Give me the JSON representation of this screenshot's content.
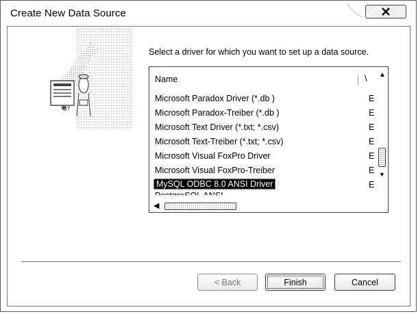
{
  "window": {
    "title": "Create New Data Source",
    "close_icon": "close-icon"
  },
  "main": {
    "prompt": "Select a driver for which you want to set up a data source.",
    "list": {
      "columns": [
        "Name",
        "\\"
      ],
      "rows": [
        {
          "name": "Microsoft Paradox Driver (*.db )",
          "version": "E"
        },
        {
          "name": "Microsoft Paradox-Treiber (*.db )",
          "version": "E"
        },
        {
          "name": "Microsoft Text Driver (*.txt; *.csv)",
          "version": "E"
        },
        {
          "name": "Microsoft Text-Treiber (*.txt; *.csv)",
          "version": "E"
        },
        {
          "name": "Microsoft Visual FoxPro Driver",
          "version": "E"
        },
        {
          "name": "Microsoft Visual FoxPro-Treiber",
          "version": "E"
        },
        {
          "name": "MySQL ODBC 8.0 ANSI Driver",
          "version": "E"
        },
        {
          "name": "PostgreSQL ANSI",
          "version": ""
        }
      ],
      "selected_index": 6
    }
  },
  "buttons": {
    "back": "< Back",
    "finish": "Finish",
    "cancel": "Cancel"
  }
}
